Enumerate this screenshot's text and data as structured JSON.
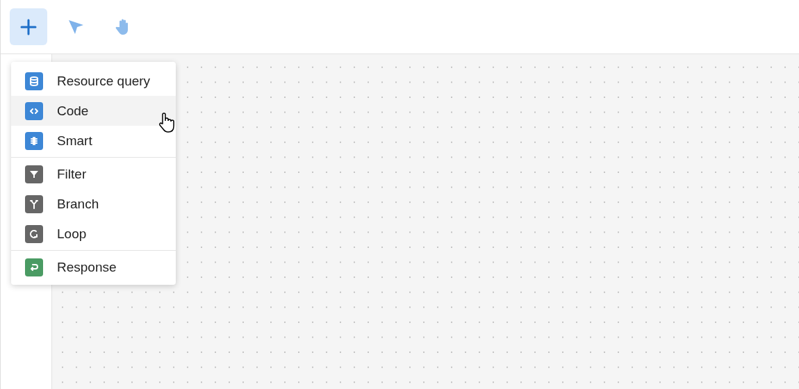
{
  "toolbar": {
    "tools": [
      {
        "kind": "add",
        "selected": true
      },
      {
        "kind": "pointer",
        "selected": false
      },
      {
        "kind": "hand",
        "selected": false
      }
    ]
  },
  "menu": {
    "groups": [
      {
        "items": [
          {
            "label": "Resource query",
            "kind": "database",
            "color": "#3d87d6",
            "hovered": false
          },
          {
            "label": "Code",
            "kind": "code",
            "color": "#3d87d6",
            "hovered": true
          },
          {
            "label": "Smart",
            "kind": "brain",
            "color": "#3d87d6",
            "hovered": false
          }
        ]
      },
      {
        "items": [
          {
            "label": "Filter",
            "kind": "filter",
            "color": "#666666",
            "hovered": false
          },
          {
            "label": "Branch",
            "kind": "branch",
            "color": "#666666",
            "hovered": false
          },
          {
            "label": "Loop",
            "kind": "loop",
            "color": "#666666",
            "hovered": false
          }
        ]
      },
      {
        "items": [
          {
            "label": "Response",
            "kind": "response",
            "color": "#4a9b63",
            "hovered": false
          }
        ]
      }
    ]
  }
}
